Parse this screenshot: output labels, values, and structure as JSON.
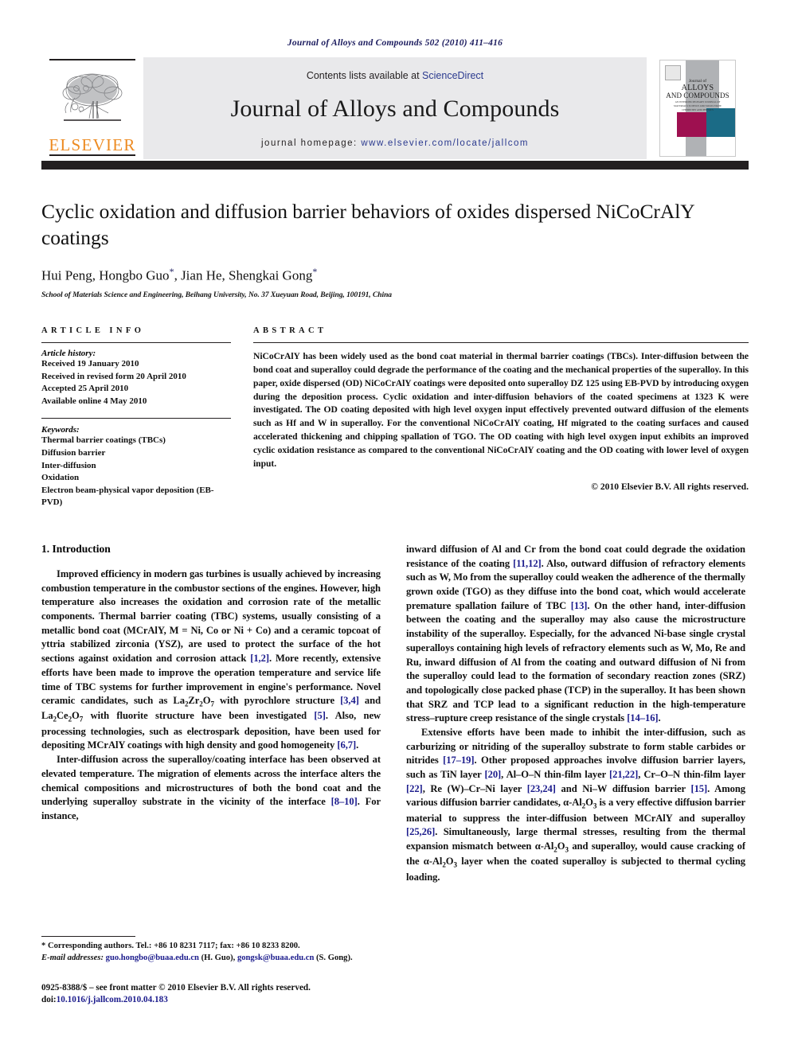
{
  "running_head": "Journal of Alloys and Compounds 502 (2010) 411–416",
  "masthead": {
    "contents_prefix": "Contents lists available at ",
    "sciencedirect": "ScienceDirect",
    "journal_name": "Journal of Alloys and Compounds",
    "homepage_prefix": "journal homepage: ",
    "homepage_url": "www.elsevier.com/locate/jallcom",
    "publisher": "ELSEVIER",
    "publisher_color": "#ED8B22",
    "link_color": "#2b3a8f",
    "cover": {
      "line1": "Journal of",
      "line2": "ALLOYS",
      "line3": "AND COMPOUNDS",
      "subtitle": "AN INTERDISCIPLINARY JOURNAL OF MATERIALS SCIENCE AND SOLID-STATE CHEMISTRY AND PHYSICS"
    }
  },
  "article": {
    "title": "Cyclic oxidation and diffusion barrier behaviors of oxides dispersed NiCoCrAlY coatings",
    "authors": "Hui Peng, Hongbo Guo*, Jian He, Shengkai Gong*",
    "affiliation": "School of Materials Science and Engineering, Beihang University, No. 37 Xueyuan Road, Beijing, 100191, China"
  },
  "article_info": {
    "heading": "ARTICLE INFO",
    "history_label": "Article history:",
    "history": [
      "Received 19 January 2010",
      "Received in revised form 20 April 2010",
      "Accepted 25 April 2010",
      "Available online 4 May 2010"
    ],
    "keywords_label": "Keywords:",
    "keywords": [
      "Thermal barrier coatings (TBCs)",
      "Diffusion barrier",
      "Inter-diffusion",
      "Oxidation",
      "Electron beam-physical vapor deposition (EB-PVD)"
    ]
  },
  "abstract": {
    "heading": "ABSTRACT",
    "text": "NiCoCrAlY has been widely used as the bond coat material in thermal barrier coatings (TBCs). Inter-diffusion between the bond coat and superalloy could degrade the performance of the coating and the mechanical properties of the superalloy. In this paper, oxide dispersed (OD) NiCoCrAlY coatings were deposited onto superalloy DZ 125 using EB-PVD by introducing oxygen during the deposition process. Cyclic oxidation and inter-diffusion behaviors of the coated specimens at 1323 K were investigated. The OD coating deposited with high level oxygen input effectively prevented outward diffusion of the elements such as Hf and W in superalloy. For the conventional NiCoCrAlY coating, Hf migrated to the coating surfaces and caused accelerated thickening and chipping spallation of TGO. The OD coating with high level oxygen input exhibits an improved cyclic oxidation resistance as compared to the conventional NiCoCrAlY coating and the OD coating with lower level of oxygen input.",
    "copyright": "© 2010 Elsevier B.V. All rights reserved."
  },
  "introduction": {
    "heading": "1. Introduction",
    "left_paragraphs": [
      "Improved efficiency in modern gas turbines is usually achieved by increasing combustion temperature in the combustor sections of the engines. However, high temperature also increases the oxidation and corrosion rate of the metallic components. Thermal barrier coating (TBC) systems, usually consisting of a metallic bond coat (MCrAlY, M = Ni, Co or Ni + Co) and a ceramic topcoat of yttria stabilized zirconia (YSZ), are used to protect the surface of the hot sections against oxidation and corrosion attack [1,2]. More recently, extensive efforts have been made to improve the operation temperature and service life time of TBC systems for further improvement in engine's performance. Novel ceramic candidates, such as La2Zr2O7 with pyrochlore structure [3,4] and La2Ce2O7 with fluorite structure have been investigated [5]. Also, new processing technologies, such as electrospark deposition, have been used for depositing MCrAlY coatings with high density and good homogeneity [6,7].",
      "Inter-diffusion across the superalloy/coating interface has been observed at elevated temperature. The migration of elements across the interface alters the chemical compositions and microstructures of both the bond coat and the underlying superalloy substrate in the vicinity of the interface [8–10]. For instance,"
    ],
    "right_paragraphs": [
      "inward diffusion of Al and Cr from the bond coat could degrade the oxidation resistance of the coating [11,12]. Also, outward diffusion of refractory elements such as W, Mo from the superalloy could weaken the adherence of the thermally grown oxide (TGO) as they diffuse into the bond coat, which would accelerate premature spallation failure of TBC [13]. On the other hand, inter-diffusion between the coating and the superalloy may also cause the microstructure instability of the superalloy. Especially, for the advanced Ni-base single crystal superalloys containing high levels of refractory elements such as W, Mo, Re and Ru, inward diffusion of Al from the coating and outward diffusion of Ni from the superalloy could lead to the formation of secondary reaction zones (SRZ) and topologically close packed phase (TCP) in the superalloy. It has been shown that SRZ and TCP lead to a significant reduction in the high-temperature stress–rupture creep resistance of the single crystals [14–16].",
      "Extensive efforts have been made to inhibit the inter-diffusion, such as carburizing or nitriding of the superalloy substrate to form stable carbides or nitrides [17–19]. Other proposed approaches involve diffusion barrier layers, such as TiN layer [20], Al–O–N thin-film layer [21,22], Cr–O–N thin-film layer [22], Re (W)–Cr–Ni layer [23,24] and Ni–W diffusion barrier [15]. Among various diffusion barrier candidates, α-Al2O3 is a very effective diffusion barrier material to suppress the inter-diffusion between MCrAlY and superalloy [25,26]. Simultaneously, large thermal stresses, resulting from the thermal expansion mismatch between α-Al2O3 and superalloy, would cause cracking of the α-Al2O3 layer when the coated superalloy is subjected to thermal cycling loading."
    ]
  },
  "footnotes": {
    "corresponding": "* Corresponding authors. Tel.: +86 10 8231 7117; fax: +86 10 8233 8200.",
    "email_label": "E-mail addresses:",
    "email1": "guo.hongbo@buaa.edu.cn",
    "email1_name": "(H. Guo),",
    "email2": "gongsk@buaa.edu.cn",
    "email2_name": "(S. Gong).",
    "issn_line": "0925-8388/$ – see front matter © 2010 Elsevier B.V. All rights reserved.",
    "doi_label": "doi:",
    "doi_value": "10.1016/j.jallcom.2010.04.183"
  }
}
